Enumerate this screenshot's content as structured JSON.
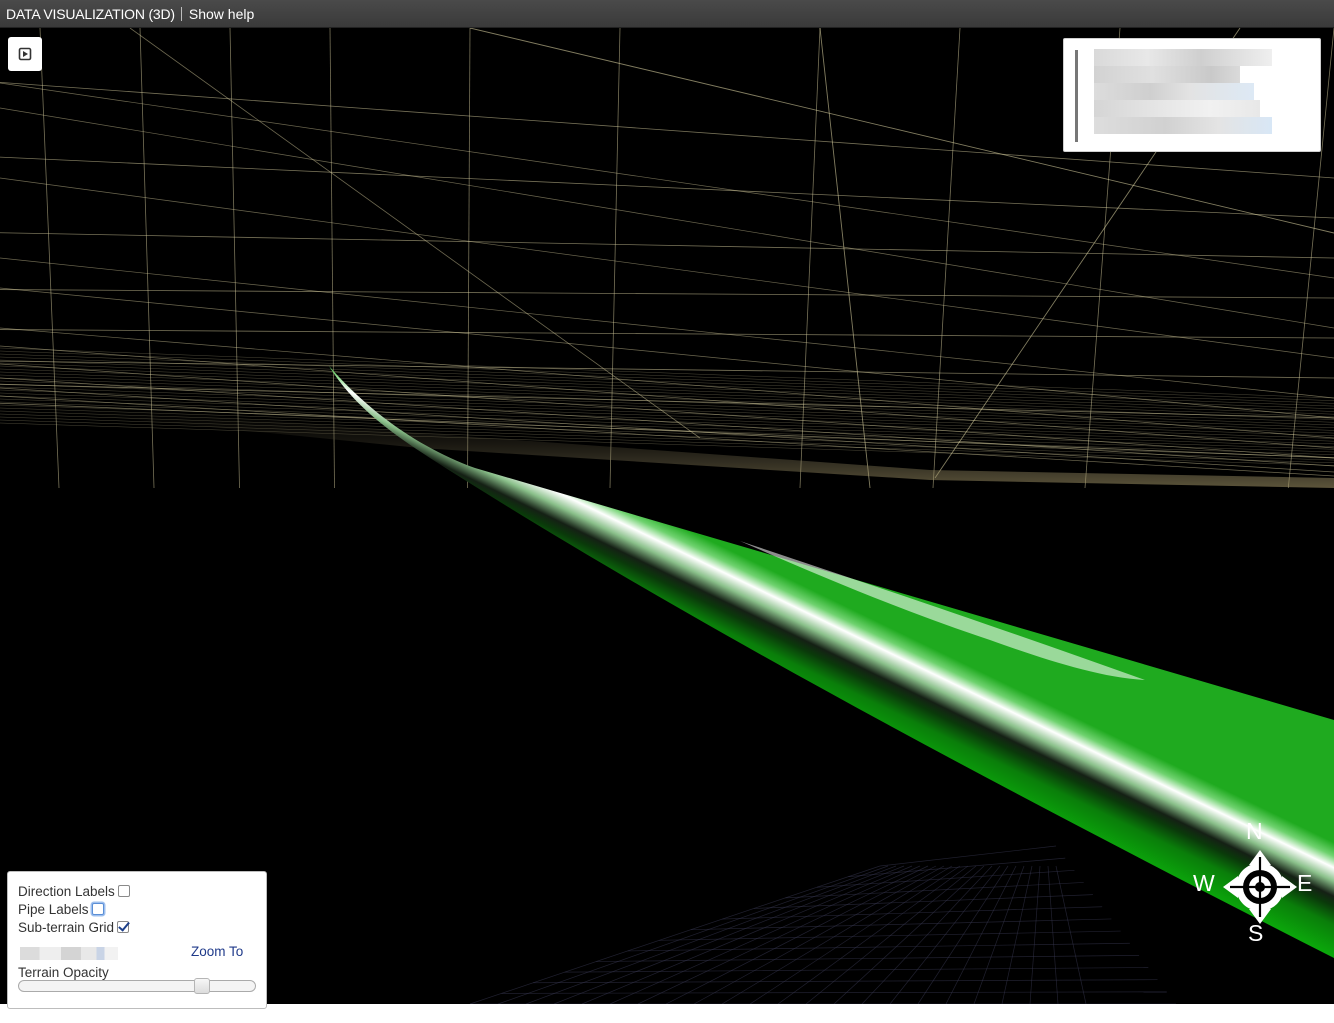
{
  "header": {
    "title": "DATA VISUALIZATION (3D)",
    "help_link": "Show help"
  },
  "scene": {
    "background": "#000000",
    "grid_color": "#d9d0a0",
    "pipe_color": "#11a811",
    "sub_grid_color": "#3a3a55"
  },
  "controls": {
    "direction_labels": {
      "label": "Direction Labels",
      "checked": false
    },
    "pipe_labels": {
      "label": "Pipe Labels",
      "checked": false
    },
    "sub_terrain_grid": {
      "label": "Sub-terrain Grid",
      "checked": true
    },
    "zoom_to": "Zoom To",
    "terrain_opacity": {
      "label": "Terrain Opacity",
      "value": 0.79
    }
  },
  "compass": {
    "north": "N",
    "south": "S",
    "east": "E",
    "west": "W"
  },
  "icons": {
    "play": "play-icon",
    "compass": "compass-arrows-icon"
  }
}
